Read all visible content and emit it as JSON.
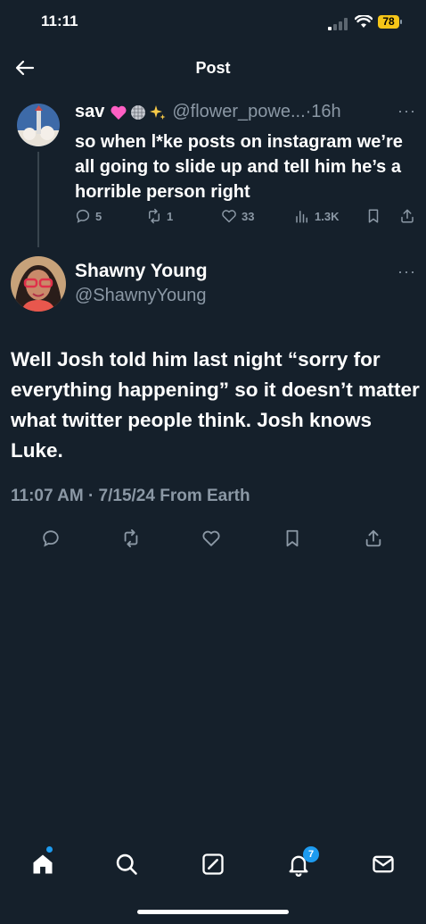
{
  "status_bar": {
    "time": "11:11",
    "battery": "78"
  },
  "header": {
    "title": "Post"
  },
  "quoted_post": {
    "name": "sav",
    "emojis": [
      "pink-heart",
      "disco-ball",
      "sparkles"
    ],
    "handle": "@flower_powe...",
    "time": "·16h",
    "more": "···",
    "text": "so when l*ke posts on instagram we’re all going to slide up and tell him he’s a horrible person right",
    "replies": "5",
    "reposts": "1",
    "likes": "33",
    "views": "1.3K"
  },
  "main_post": {
    "name": "Shawny Young",
    "handle": "@ShawnyYoung",
    "more": "···",
    "text": "Well Josh told him last night “sorry for everything happening” so it doesn’t matter what twitter people think. Josh knows Luke.",
    "meta": "11:07 AM · 7/15/24 From Earth"
  },
  "tab_bar": {
    "notifications_count": "7"
  },
  "colors": {
    "background": "#15202b",
    "muted": "#8b98a5",
    "accent": "#1d9bf0",
    "battery": "#f5c518"
  }
}
